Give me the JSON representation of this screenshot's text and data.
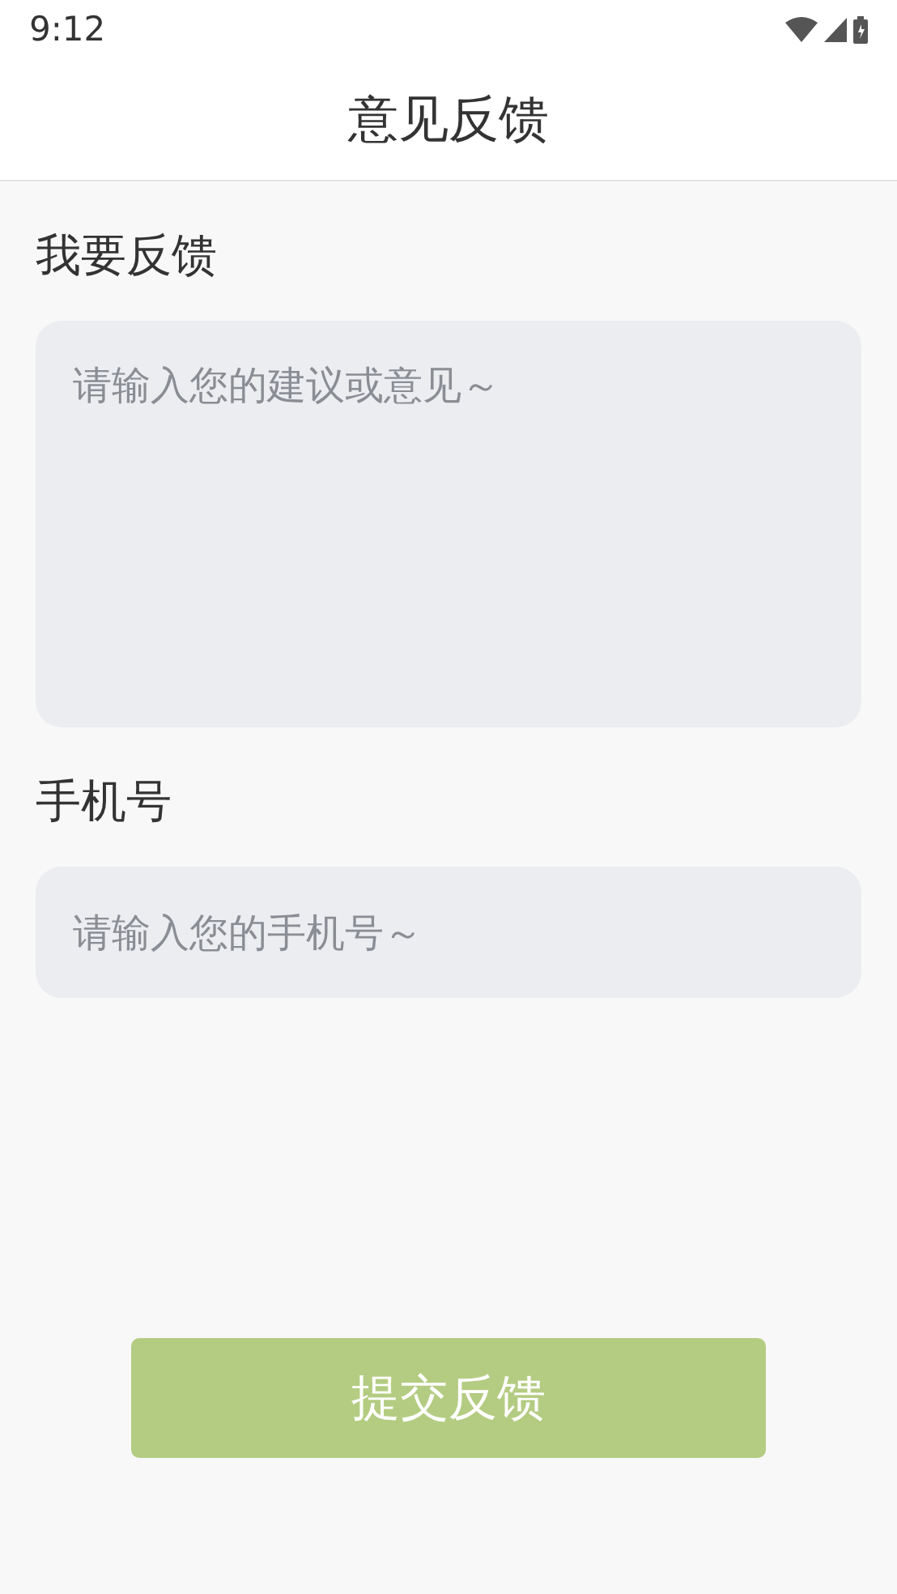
{
  "status_bar": {
    "time": "9:12"
  },
  "header": {
    "title": "意见反馈"
  },
  "form": {
    "feedback_label": "我要反馈",
    "feedback_placeholder": "请输入您的建议或意见～",
    "phone_label": "手机号",
    "phone_placeholder": "请输入您的手机号～"
  },
  "submit_button": "提交反馈"
}
